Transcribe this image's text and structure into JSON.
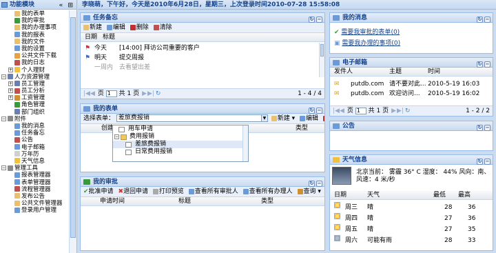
{
  "sidebar": {
    "title": "功能模块",
    "header_buttons": "« ⊞",
    "items": [
      {
        "label": "我的表单",
        "level": 2,
        "icon_color": "#e8c070",
        "icon": "form-icon"
      },
      {
        "label": "我的审批",
        "level": 2,
        "icon_color": "#3a9a3a",
        "icon": "checkmark-icon"
      },
      {
        "label": "我的办理事项",
        "level": 2,
        "icon_color": "#e8c070",
        "icon": "form-icon"
      },
      {
        "label": "我的报表",
        "level": 2,
        "icon_color": "#6a9bd8",
        "icon": "report-icon"
      },
      {
        "label": "我的文件",
        "level": 2,
        "icon_color": "#e8c070",
        "icon": "file-icon"
      },
      {
        "label": "我的设置",
        "level": 2,
        "icon_color": "#6a9bd8",
        "icon": "settings-icon"
      },
      {
        "label": "公共文件下载",
        "level": 2,
        "icon_color": "#e8a040",
        "icon": "download-icon"
      },
      {
        "label": "我的日志",
        "level": 2,
        "icon_color": "#c05050",
        "icon": "log-icon"
      },
      {
        "label": "个人理财",
        "level": 2,
        "icon_color": "#f0c040",
        "icon": "finance-icon",
        "expander": "+"
      },
      {
        "label": "人力资源管理",
        "level": 1,
        "icon_color": "#6a7fb0",
        "icon": "hr-icon",
        "expander": "−"
      },
      {
        "label": "员工管理",
        "level": 2,
        "icon_color": "#6a7fb0",
        "icon": "employee-icon",
        "expander": "+"
      },
      {
        "label": "员工分析",
        "level": 2,
        "icon_color": "#c05050",
        "icon": "analysis-icon",
        "expander": "+"
      },
      {
        "label": "工资管理",
        "level": 2,
        "icon_color": "#d09030",
        "icon": "salary-icon",
        "expander": "+"
      },
      {
        "label": "角色管理",
        "level": 2,
        "icon_color": "#3a9a3a",
        "icon": "role-icon"
      },
      {
        "label": "部门组织",
        "level": 2,
        "icon_color": "#6a7fb0",
        "icon": "org-icon"
      },
      {
        "label": "附件",
        "level": 1,
        "icon_color": "#8a8a8a",
        "icon": "attachment-icon",
        "expander": "−"
      },
      {
        "label": "我的消息",
        "level": 2,
        "icon_color": "#6a9bd8",
        "icon": "message-icon"
      },
      {
        "label": "任务备忘",
        "level": 2,
        "icon_color": "#6a9bd8",
        "icon": "memo-icon"
      },
      {
        "label": "公告",
        "level": 2,
        "icon_color": "#c05050",
        "icon": "notice-icon"
      },
      {
        "label": "电子邮箱",
        "level": 2,
        "icon_color": "#6a9bd8",
        "icon": "mail-icon"
      },
      {
        "label": "万年历",
        "level": 2,
        "icon_color": "#d0d0d0",
        "icon": "calendar-icon"
      },
      {
        "label": "天气信息",
        "level": 2,
        "icon_color": "#f0c040",
        "icon": "weather-icon"
      },
      {
        "label": "管理工具",
        "level": 1,
        "icon_color": "#8a8a8a",
        "icon": "tools-icon",
        "expander": "−"
      },
      {
        "label": "报表管理器",
        "level": 2,
        "icon_color": "#6a9bd8",
        "icon": "report-manager-icon"
      },
      {
        "label": "表单管理器",
        "level": 2,
        "icon_color": "#6a9bd8",
        "icon": "form-manager-icon"
      },
      {
        "label": "流程管理器",
        "level": 2,
        "icon_color": "#c05050",
        "icon": "workflow-icon"
      },
      {
        "label": "发布公告",
        "level": 2,
        "icon_color": "#e8c070",
        "icon": "publish-icon"
      },
      {
        "label": "公共文件管理器",
        "level": 2,
        "icon_color": "#e8c070",
        "icon": "public-file-icon"
      },
      {
        "label": "登录用户管理",
        "level": 2,
        "icon_color": "#6a9bd8",
        "icon": "user-icon"
      }
    ]
  },
  "topbar": {
    "text": "李晓萌，下午好，今天是2010年6月28日，星期三，上次登录时间2010-07-28 15:58:08"
  },
  "memo": {
    "title": "任务备忘",
    "toolbar": [
      "新建",
      "编辑",
      "删除",
      "清除"
    ],
    "columns": [
      "日期",
      "标题"
    ],
    "rows": [
      {
        "date": "今天",
        "title": "[14:00] 拜访公司重要的客户"
      },
      {
        "date": "明天",
        "title": "提交周报"
      },
      {
        "date": "一周内",
        "title": "去看望出差"
      }
    ],
    "pager": {
      "page": "1",
      "of": "共",
      "total": "1",
      "unit": "页",
      "count": "1 - 4 / 4"
    }
  },
  "forms": {
    "title": "我的表单",
    "select_label": "选择表单：",
    "select_value": "差旅费报销",
    "toolbar": [
      "新建",
      "编辑",
      "删除"
    ],
    "columns": [
      "创建",
      "类型"
    ],
    "dropdown": [
      {
        "label": "用车申请",
        "level": 2
      },
      {
        "label": "费用报销",
        "level": 1,
        "expander": "−"
      },
      {
        "label": "差旅费报销",
        "level": 2,
        "selected": true
      },
      {
        "label": "日常费用报销",
        "level": 2
      }
    ]
  },
  "approval": {
    "title": "我的审批",
    "toolbar": [
      "批准申请",
      "退回申请",
      "打印预览",
      "查看所有审批人",
      "查看所有办理人",
      "查询"
    ],
    "columns": [
      "申请时间",
      "标题",
      "类型"
    ]
  },
  "messages": {
    "title": "我的消息",
    "items": [
      "需要我审批的表单",
      "需要我办理的事项"
    ],
    "counts": [
      "(0)",
      "(0)"
    ]
  },
  "email": {
    "title": "电子邮箱",
    "columns": [
      "发件人",
      "主题",
      "时间"
    ],
    "rows": [
      {
        "from": "putdb.com",
        "subject": "请不要对此...",
        "time": "2010-5-19 16:03"
      },
      {
        "from": "putdb.com",
        "subject": "欢迎访问...",
        "time": "2010-5-19 16:02"
      }
    ],
    "pager": {
      "page": "1",
      "of": "共",
      "total": "1",
      "unit": "页",
      "count": "1 - 2 / 2"
    }
  },
  "notice": {
    "title": "公告"
  },
  "weather": {
    "title": "天气信息",
    "summary": "北京当前： 雾霾 36° C 湿度： 44% 风向：南、风速：4 米/秒",
    "columns": [
      "日期",
      "天气",
      "最低",
      "最高"
    ],
    "rows": [
      {
        "day": "周三",
        "cond": "晴",
        "low": "28",
        "high": "36"
      },
      {
        "day": "周四",
        "cond": "晴",
        "low": "27",
        "high": "36"
      },
      {
        "day": "周五",
        "cond": "晴",
        "low": "27",
        "high": "35"
      },
      {
        "day": "周六",
        "cond": "可能有雨",
        "low": "28",
        "high": "33"
      }
    ]
  }
}
